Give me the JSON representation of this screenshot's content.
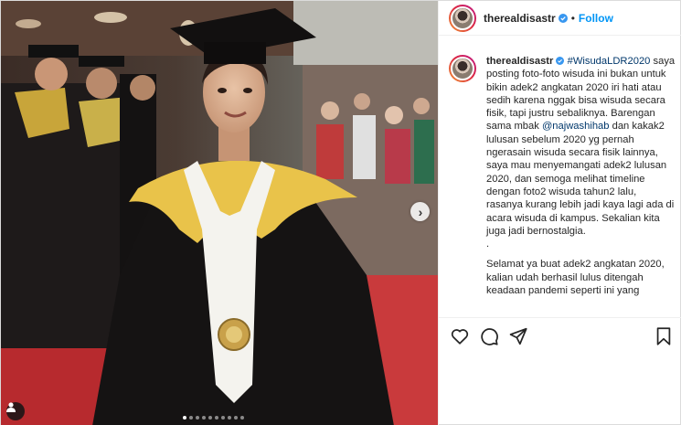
{
  "post": {
    "username": "therealdisastr",
    "follow_label": "Follow",
    "separator": "•",
    "verified_icon": "verified-badge-icon",
    "carousel": {
      "total_slides": 10,
      "active_slide": 1
    }
  },
  "caption": {
    "username": "therealdisastr",
    "hashtag": "#WisudaLDR2020",
    "paragraph1_before_mention": "saya posting foto-foto wisuda ini bukan untuk bikin adek2 angkatan 2020 iri hati atau sedih karena nggak bisa wisuda secara fisik, tapi justru sebaliknya. Barengan sama mbak",
    "mention": "@najwashihab",
    "paragraph1_after_mention": "dan kakak2 lulusan sebelum 2020 yg pernah ngerasain wisuda secara fisik lainnya, saya mau menyemangati adek2 lulusan 2020, dan semoga melihat timeline dengan foto2 wisuda tahun2 lalu, rasanya kurang lebih jadi kaya lagi ada di acara wisuda di kampus. Sekalian kita juga jadi bernostalgia.",
    "dot_line": ".",
    "paragraph2": "Selamat ya buat adek2 angkatan 2020, kalian udah berhasil lulus ditengah keadaan pandemi seperti ini yang"
  },
  "icons": {
    "like": "heart-icon",
    "comment": "comment-icon",
    "share": "paper-plane-icon",
    "save": "bookmark-icon",
    "next": "chevron-right-icon",
    "tag": "user-tag-icon"
  },
  "colors": {
    "link": "#00376b",
    "follow": "#0095f6",
    "border": "#dbdbdb"
  }
}
